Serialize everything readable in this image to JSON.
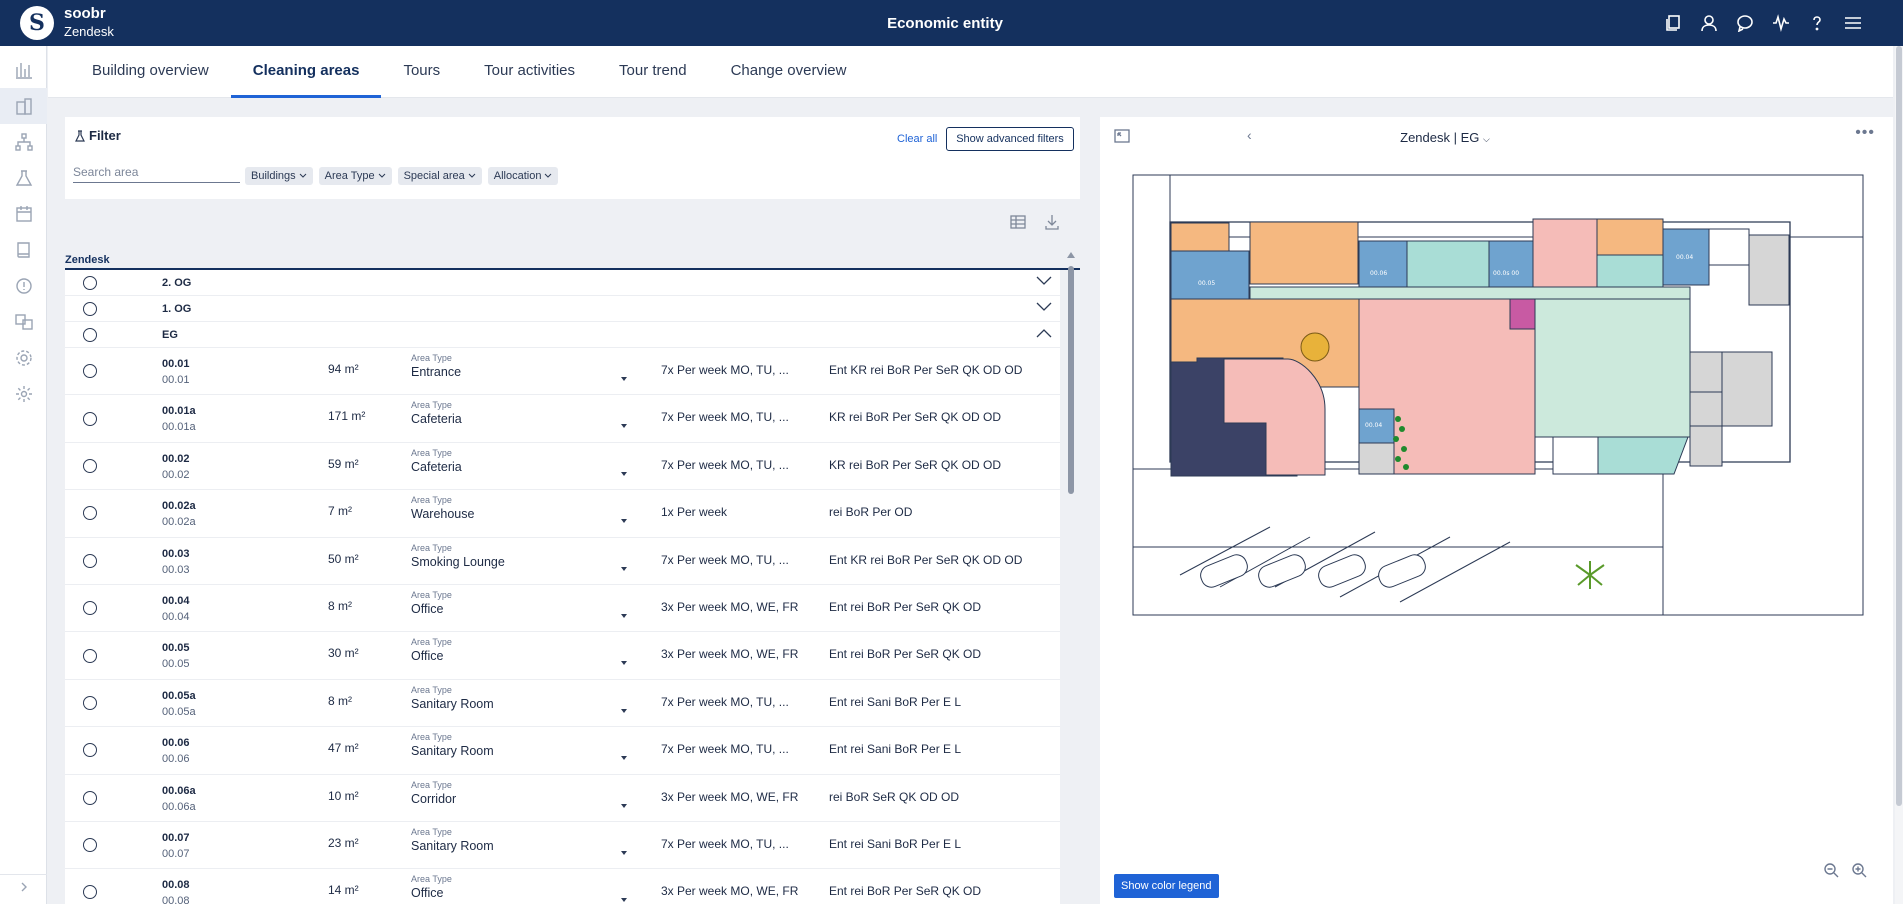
{
  "header": {
    "brand_name": "soobr",
    "brand_sub": "Zendesk",
    "brand_logo_letter": "S",
    "title": "Economic entity",
    "icons": [
      "copy-icon",
      "user-icon",
      "chat-icon",
      "activity-icon",
      "help-icon",
      "menu-icon"
    ]
  },
  "rail": {
    "icons": [
      "chart-icon",
      "building-icon",
      "sitemap-icon",
      "flask-icon",
      "calendar-icon",
      "book-icon",
      "alert-icon",
      "translate-icon",
      "settings-gear-icon",
      "settings-icon"
    ]
  },
  "tabs": [
    {
      "label": "Building overview",
      "active": false
    },
    {
      "label": "Cleaning areas",
      "active": true
    },
    {
      "label": "Tours",
      "active": false
    },
    {
      "label": "Tour activities",
      "active": false
    },
    {
      "label": "Tour trend",
      "active": false
    },
    {
      "label": "Change overview",
      "active": false
    }
  ],
  "filter": {
    "title": "Filter",
    "clear_all": "Clear all",
    "advanced": "Show advanced filters",
    "search_placeholder": "Search area",
    "chips": [
      "Buildings",
      "Area Type",
      "Special area",
      "Allocation"
    ]
  },
  "list": {
    "header": "Zendesk",
    "groups": [
      {
        "name": "2. OG",
        "expanded": false
      },
      {
        "name": "1. OG",
        "expanded": false
      },
      {
        "name": "EG",
        "expanded": true
      }
    ],
    "type_label": "Area Type",
    "rows": [
      {
        "code": "00.01",
        "sub": "00.01",
        "size": "94 m²",
        "type": "Entrance",
        "freq": "7x Per week MO, TU, ...",
        "services": "Ent KR rei BoR Per SeR QK OD OD"
      },
      {
        "code": "00.01a",
        "sub": "00.01a",
        "size": "171 m²",
        "type": "Cafeteria",
        "freq": "7x Per week MO, TU, ...",
        "services": "KR rei BoR Per SeR QK OD OD"
      },
      {
        "code": "00.02",
        "sub": "00.02",
        "size": "59 m²",
        "type": "Cafeteria",
        "freq": "7x Per week MO, TU, ...",
        "services": "KR rei BoR Per SeR QK OD OD"
      },
      {
        "code": "00.02a",
        "sub": "00.02a",
        "size": "7 m²",
        "type": "Warehouse",
        "freq": "1x Per week",
        "services": "rei BoR Per OD"
      },
      {
        "code": "00.03",
        "sub": "00.03",
        "size": "50 m²",
        "type": "Smoking Lounge",
        "freq": "7x Per week MO, TU, ...",
        "services": "Ent KR rei BoR Per SeR QK OD OD"
      },
      {
        "code": "00.04",
        "sub": "00.04",
        "size": "8 m²",
        "type": "Office",
        "freq": "3x Per week MO, WE, FR",
        "services": "Ent rei BoR Per SeR QK OD"
      },
      {
        "code": "00.05",
        "sub": "00.05",
        "size": "30 m²",
        "type": "Office",
        "freq": "3x Per week MO, WE, FR",
        "services": "Ent rei BoR Per SeR QK OD"
      },
      {
        "code": "00.05a",
        "sub": "00.05a",
        "size": "8 m²",
        "type": "Sanitary Room",
        "freq": "7x Per week MO, TU, ...",
        "services": "Ent rei Sani BoR Per E L"
      },
      {
        "code": "00.06",
        "sub": "00.06",
        "size": "47 m²",
        "type": "Sanitary Room",
        "freq": "7x Per week MO, TU, ...",
        "services": "Ent rei Sani BoR Per E L"
      },
      {
        "code": "00.06a",
        "sub": "00.06a",
        "size": "10 m²",
        "type": "Corridor",
        "freq": "3x Per week MO, WE, FR",
        "services": "rei BoR SeR QK OD OD"
      },
      {
        "code": "00.07",
        "sub": "00.07",
        "size": "23 m²",
        "type": "Sanitary Room",
        "freq": "7x Per week MO, TU, ...",
        "services": "Ent rei Sani BoR Per E L"
      },
      {
        "code": "00.08",
        "sub": "00.08",
        "size": "14 m²",
        "type": "Office",
        "freq": "3x Per week MO, WE, FR",
        "services": "Ent rei BoR Per SeR QK OD"
      }
    ]
  },
  "map": {
    "title": "Zendesk | EG",
    "legend_button": "Show color legend",
    "room_labels": [
      "00.05",
      "00.06",
      "00.0s 00",
      "00.04",
      "00.04"
    ],
    "colors": {
      "office": "#6fa3cf",
      "orange": "#f5b880",
      "pink": "#f5bcb8",
      "teal": "#a9ddd6",
      "mint": "#cce9dc",
      "navy": "#3b4266",
      "magenta": "#c85aa3",
      "gray": "#d6d6d6"
    }
  },
  "colors": {
    "header_bg": "#14305e",
    "accent": "#1f63d6"
  }
}
